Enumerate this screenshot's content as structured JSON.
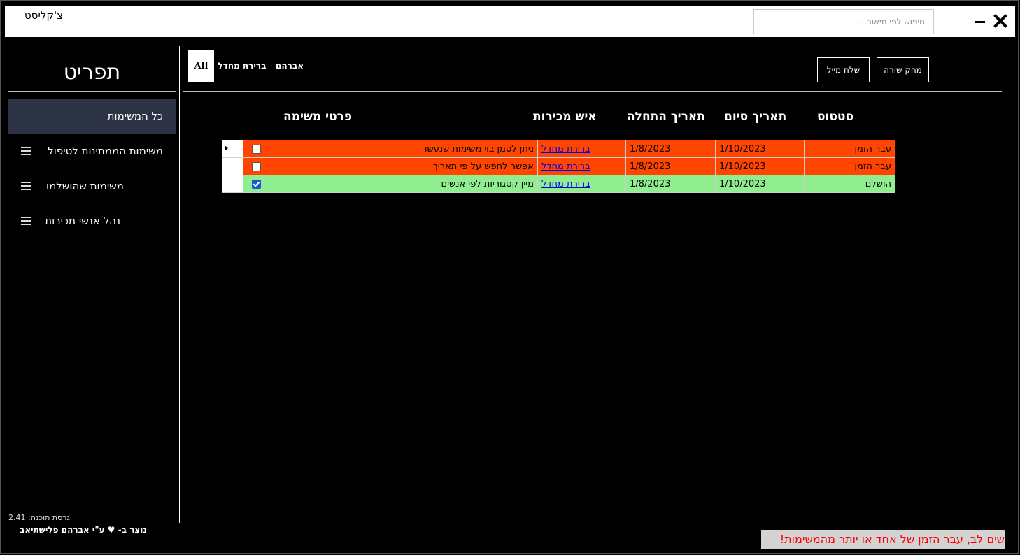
{
  "titlebar": {
    "app_title": "צ'קליסט",
    "search_placeholder": "חיפוש לפי תיאור..."
  },
  "sidebar": {
    "brand": "תפריט",
    "items": [
      {
        "label": "כל המשימות",
        "active": true
      },
      {
        "label": "משימות הממתינות לטיפול",
        "icon": "menu-icon"
      },
      {
        "label": "משימות שהושלמו",
        "icon": "menu-icon"
      },
      {
        "label": "נהל אנשי מכירות",
        "icon": "menu-icon"
      }
    ],
    "version": "גרסת תוכנה: 2.41",
    "credit_prefix": "נוצר ב-",
    "credit_suffix": "ע\"י אברהם פלישתיאב"
  },
  "tabs": [
    {
      "label": "All",
      "active": true
    },
    {
      "label": "ברירת מחדל"
    },
    {
      "label": "אברהם"
    }
  ],
  "toolbar": {
    "delete_row": "מחק שורה",
    "send_mail": "שלח מייל"
  },
  "table": {
    "headers": {
      "details": "פרטי משימה",
      "salesperson": "איש מכירות",
      "start_date": "תאריך התחלה",
      "end_date": "תאריך סיום",
      "status": "סטטוס"
    },
    "rows": [
      {
        "checked": false,
        "details": "ניתן לסמן בוי משימות שנעשו",
        "salesperson": "ברירת מחדל",
        "start": "1/8/2023",
        "end": "1/10/2023",
        "status": "עבר הזמן",
        "state": "overdue"
      },
      {
        "checked": false,
        "details": "אפשר לחפש על פי תאריך",
        "salesperson": "ברירת מחדל",
        "start": "1/8/2023",
        "end": "1/10/2023",
        "status": "עבר הזמן",
        "state": "overdue"
      },
      {
        "checked": true,
        "details": "מיין קטגוריות לפי אנשים",
        "salesperson": "ברירת מחדל",
        "start": "1/8/2023",
        "end": "1/10/2023",
        "status": "הושלם",
        "state": "done"
      }
    ]
  },
  "colors": {
    "overdue": "#ff4500",
    "done": "#90ee90",
    "sidebar_active": "#2b3344",
    "warning_text": "#ff0000"
  },
  "warning": "שים לב, עבר הזמן של אחד או יותר מהמשימות!"
}
